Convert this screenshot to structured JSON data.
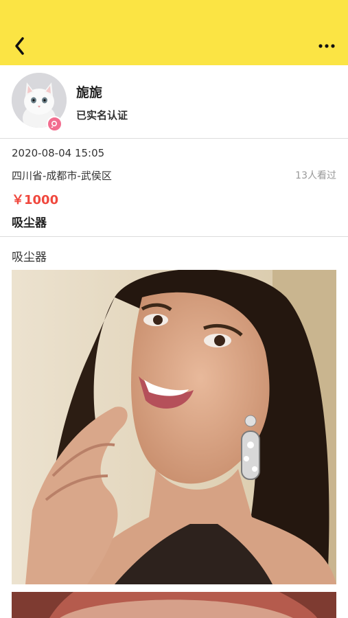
{
  "header": {
    "back_icon": "chevron-left-icon",
    "more_icon": "ellipsis-icon",
    "bar_color": "#fbe444"
  },
  "profile": {
    "name": "旎旎",
    "verified_label": "已实名认证",
    "badge_color": "#f26d8f"
  },
  "post": {
    "date": "2020-08-04 15:05",
    "location": "四川省-成都市-武侯区",
    "views": "13人看过",
    "price": "￥1000",
    "title": "吸尘器",
    "description": "吸尘器",
    "price_color": "#f0483e"
  }
}
